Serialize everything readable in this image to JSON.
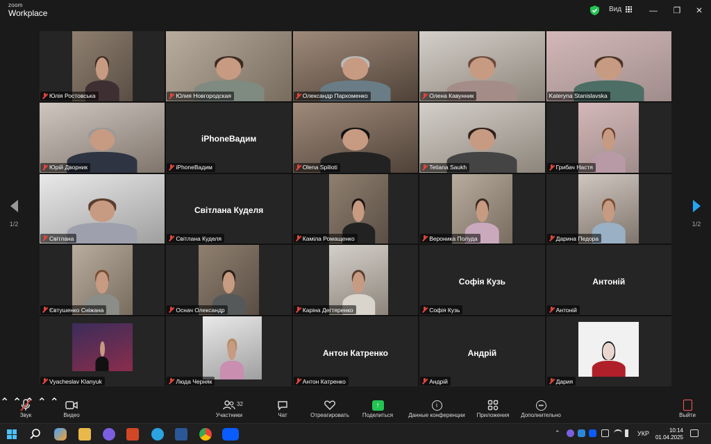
{
  "app": {
    "brand_small": "zoom",
    "brand_large": "Workplace",
    "view_label": "Вид"
  },
  "pager": {
    "left_label": "1/2",
    "right_label": "1/2"
  },
  "participants": [
    {
      "name": "Юлія Ростовська",
      "display": "",
      "video": true
    },
    {
      "name": "Юлия Новгородская",
      "display": "",
      "video": true
    },
    {
      "name": "Олександр Пархоменко",
      "display": "",
      "video": true
    },
    {
      "name": "Олена Кавунник",
      "display": "",
      "video": true
    },
    {
      "name": "Kateryna Stanislavska",
      "display": "",
      "video": true,
      "active": true
    },
    {
      "name": "Юрій Дворник",
      "display": "",
      "video": true
    },
    {
      "name": "iPhoneВадим",
      "display": "iPhoneВадим",
      "video": false
    },
    {
      "name": "Olena Spilioti",
      "display": "",
      "video": true
    },
    {
      "name": "Tetiana Saukh",
      "display": "",
      "video": true
    },
    {
      "name": "Грибач Настя",
      "display": "",
      "video": true
    },
    {
      "name": "Світлана",
      "display": "",
      "video": true
    },
    {
      "name": "Світлана Куделя",
      "display": "Світлана Куделя",
      "video": false
    },
    {
      "name": "Каміла Ромащенко",
      "display": "",
      "video": true
    },
    {
      "name": "Вероника Полуда",
      "display": "",
      "video": true
    },
    {
      "name": "Дарина Педора",
      "display": "",
      "video": true
    },
    {
      "name": "Євтушенко Сніжана",
      "display": "",
      "video": true
    },
    {
      "name": "Оснач Олександр",
      "display": "",
      "video": true
    },
    {
      "name": "Каріна Дегтяренко",
      "display": "",
      "video": true
    },
    {
      "name": "Софія Кузь",
      "display": "Софія Кузь",
      "video": false
    },
    {
      "name": "Антоній",
      "display": "Антоній",
      "video": false
    },
    {
      "name": "Vyacheslav Klanyuk",
      "display": "",
      "video": true
    },
    {
      "name": "Люда Черняк",
      "display": "",
      "video": true
    },
    {
      "name": "Антон Катренко",
      "display": "Антон Катренко",
      "video": false
    },
    {
      "name": "Андрій",
      "display": "Андрій",
      "video": false
    },
    {
      "name": "Дария",
      "display": "",
      "video": true
    }
  ],
  "toolbar": {
    "audio": "Звук",
    "video": "Видео",
    "participants": "Участники",
    "participants_count": "32",
    "chat": "Чат",
    "react": "Отреагировать",
    "share": "Поделиться",
    "meeting_info": "Данные конференции",
    "apps": "Приложения",
    "more": "Дополнительно",
    "leave": "Выйти"
  },
  "taskbar": {
    "language": "УКР",
    "time": "10:14",
    "date": "01.04.2025"
  },
  "colors": {
    "active_border": "#3ddc84",
    "mic_off": "#e0453c",
    "share_green": "#23c552",
    "pager_blue": "#23a5f5"
  }
}
